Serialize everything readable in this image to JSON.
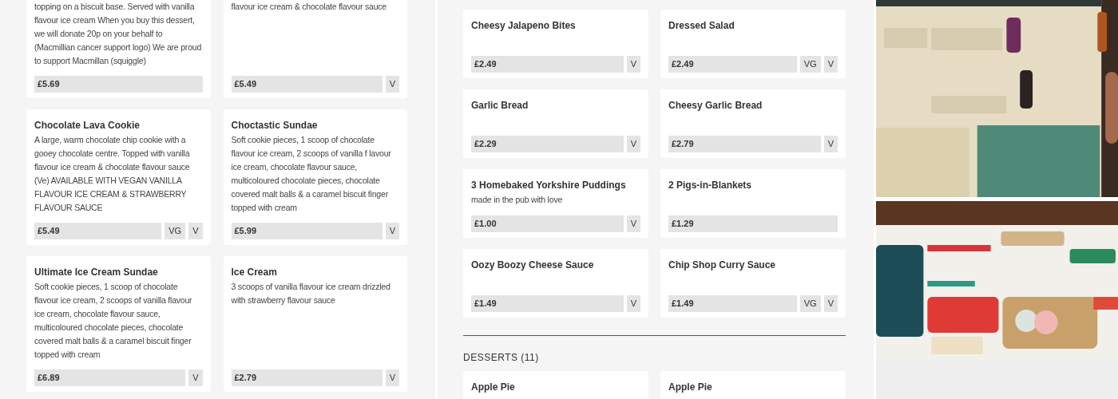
{
  "left_panel": {
    "cards": [
      {
        "description": "topping on a biscuit base. Served with vanilla flavour ice cream When you buy this dessert, we will donate 20p on your behalf to (Macmillian cancer support logo) We are proud to support Macmillan (squiggle)",
        "price": "£5.69"
      },
      {
        "description": "flavour ice cream & chocolate flavour sauce",
        "price": "£5.49",
        "tags": [
          "V"
        ]
      },
      {
        "title": "Chocolate Lava Cookie",
        "description": "A large, warm chocolate chip cookie with a gooey chocolate centre. Topped with vanilla flavour ice cream & chocolate flavour sauce (Ve) AVAILABLE WITH VEGAN VANILLA FLAVOUR ICE CREAM & STRAWBERRY FLAVOUR SAUCE",
        "price": "£5.49",
        "tags": [
          "VG",
          "V"
        ]
      },
      {
        "title": "Choctastic Sundae",
        "description": "Soft cookie pieces, 1 scoop of chocolate flavour ice cream, 2 scoops of vanilla f lavour ice cream, chocolate flavour sauce, multicoloured chocolate pieces, chocolate covered malt balls & a caramel biscuit finger topped with cream",
        "price": "£5.99",
        "tags": [
          "V"
        ]
      },
      {
        "title": "Ultimate Ice Cream Sundae",
        "description": "Soft cookie pieces, 1 scoop of chocolate flavour ice cream, 2 scoops of vanilla flavour ice cream, chocolate flavour sauce, multicoloured chocolate pieces, chocolate covered malt balls & a caramel biscuit finger topped with cream",
        "price": "£6.89",
        "tags": [
          "V"
        ]
      },
      {
        "title": "Ice Cream",
        "description": "3 scoops of vanilla flavour ice cream drizzled with strawberry flavour sauce",
        "price": "£2.79",
        "tags": [
          "V"
        ]
      }
    ]
  },
  "middle_panel": {
    "cards": [
      {
        "title": "Cheesy Jalapeno Bites",
        "price": "£2.49",
        "tags": [
          "V"
        ]
      },
      {
        "title": "Dressed Salad",
        "price": "£2.49",
        "tags": [
          "VG",
          "V"
        ]
      },
      {
        "title": "Garlic Bread",
        "price": "£2.29",
        "tags": [
          "V"
        ]
      },
      {
        "title": "Cheesy Garlic Bread",
        "price": "£2.79",
        "tags": [
          "V"
        ]
      },
      {
        "title": "3 Homebaked Yorkshire Puddings",
        "description": "made in the pub with love",
        "price": "£1.00",
        "tags": [
          "V"
        ]
      },
      {
        "title": "2 Pigs-in-Blankets",
        "price": "£1.29"
      },
      {
        "title": "Oozy Boozy Cheese Sauce",
        "price": "£1.49",
        "tags": [
          "V"
        ]
      },
      {
        "title": "Chip Shop Curry Sauce",
        "price": "£1.49",
        "tags": [
          "VG",
          "V"
        ]
      }
    ],
    "section": {
      "title": "DESSERTS (11)",
      "cards": [
        {
          "title": "Apple Pie"
        },
        {
          "title": "Apple Pie"
        }
      ]
    }
  }
}
